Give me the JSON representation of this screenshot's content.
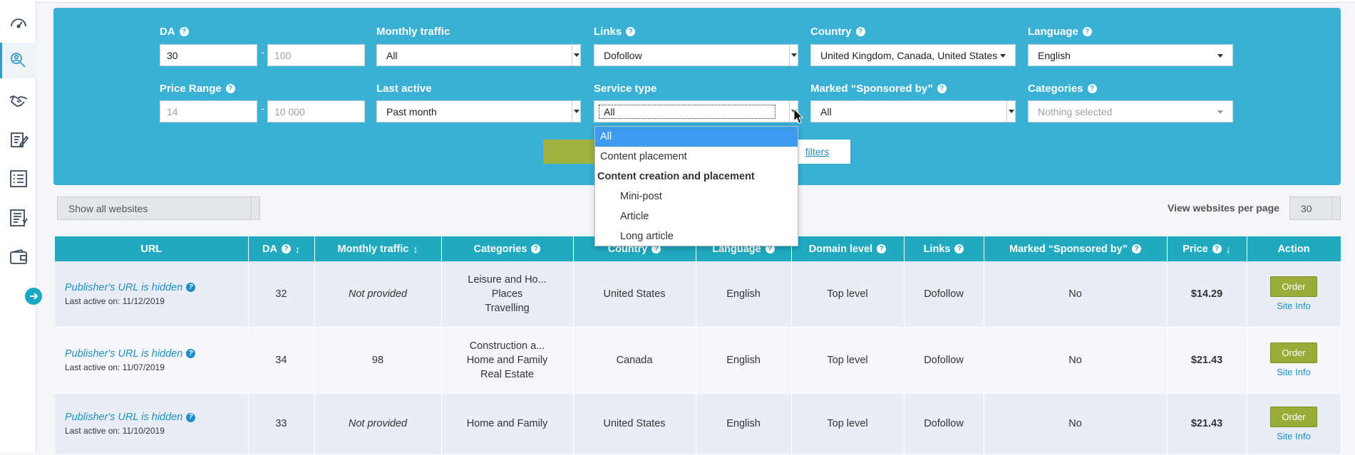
{
  "sidebar": {
    "items": [
      {
        "icon": "speedometer-icon"
      },
      {
        "icon": "search-user-icon",
        "active": true
      },
      {
        "icon": "handshake-icon"
      },
      {
        "icon": "edit-document-icon"
      },
      {
        "icon": "list-icon"
      },
      {
        "icon": "report-icon"
      },
      {
        "icon": "wallet-icon"
      }
    ],
    "toggle_icon": "arrow-right-icon"
  },
  "filters": {
    "da": {
      "label": "DA",
      "min_value": "30",
      "max_placeholder": "100"
    },
    "monthly_traffic": {
      "label": "Monthly traffic",
      "value": "All"
    },
    "links": {
      "label": "Links",
      "value": "Dofollow"
    },
    "country": {
      "label": "Country",
      "value": "United Kingdom, Canada, United States"
    },
    "language": {
      "label": "Language",
      "value": "English"
    },
    "price_range": {
      "label": "Price Range",
      "min_placeholder": "14",
      "max_placeholder": "10 000"
    },
    "last_active": {
      "label": "Last active",
      "value": "Past month"
    },
    "service_type": {
      "label": "Service type",
      "value": "All"
    },
    "marked_sponsored": {
      "label": "Marked “Sponsored by”",
      "value": "All"
    },
    "categories": {
      "label": "Categories",
      "placeholder": "Nothing selected"
    },
    "reset_label": "filters"
  },
  "service_dropdown": {
    "options": [
      {
        "label": "All",
        "kind": "selected"
      },
      {
        "label": "Content placement",
        "kind": "normal"
      },
      {
        "label": "Content creation and placement",
        "kind": "group"
      },
      {
        "label": "Mini-post",
        "kind": "sub"
      },
      {
        "label": "Article",
        "kind": "sub"
      },
      {
        "label": "Long article",
        "kind": "sub"
      }
    ]
  },
  "toolbar": {
    "show_select": "Show all websites",
    "per_page_label": "View websites per page",
    "per_page_value": "30"
  },
  "table": {
    "headers": {
      "url": "URL",
      "da": "DA",
      "traffic": "Monthly traffic",
      "categories": "Categories",
      "country": "Country",
      "language": "Language",
      "domain_level": "Domain level",
      "links": "Links",
      "sponsored": "Marked “Sponsored by”",
      "price": "Price",
      "action": "Action"
    },
    "rows": [
      {
        "url": "Publisher's URL is hidden",
        "last_active": "Last active on: 11/12/2019",
        "da": "32",
        "traffic": "Not provided",
        "categories": [
          "Leisure and Ho...",
          "Places",
          "Travelling"
        ],
        "country": "United States",
        "language": "English",
        "domain_level": "Top level",
        "links": "Dofollow",
        "sponsored": "No",
        "price": "$14.29",
        "order": "Order",
        "site_info": "Site Info"
      },
      {
        "url": "Publisher's URL is hidden",
        "last_active": "Last active on: 11/07/2019",
        "da": "34",
        "traffic": "98",
        "categories": [
          "Construction a...",
          "Home and Family",
          "Real Estate"
        ],
        "country": "Canada",
        "language": "English",
        "domain_level": "Top level",
        "links": "Dofollow",
        "sponsored": "No",
        "price": "$21.43",
        "order": "Order",
        "site_info": "Site Info"
      },
      {
        "url": "Publisher's URL is hidden",
        "last_active": "Last active on: 11/10/2019",
        "da": "33",
        "traffic": "Not provided",
        "categories": [
          "Home and Family"
        ],
        "country": "United States",
        "language": "English",
        "domain_level": "Top level",
        "links": "Dofollow",
        "sponsored": "No",
        "price": "$21.43",
        "order": "Order",
        "site_info": "Site Info"
      }
    ]
  }
}
